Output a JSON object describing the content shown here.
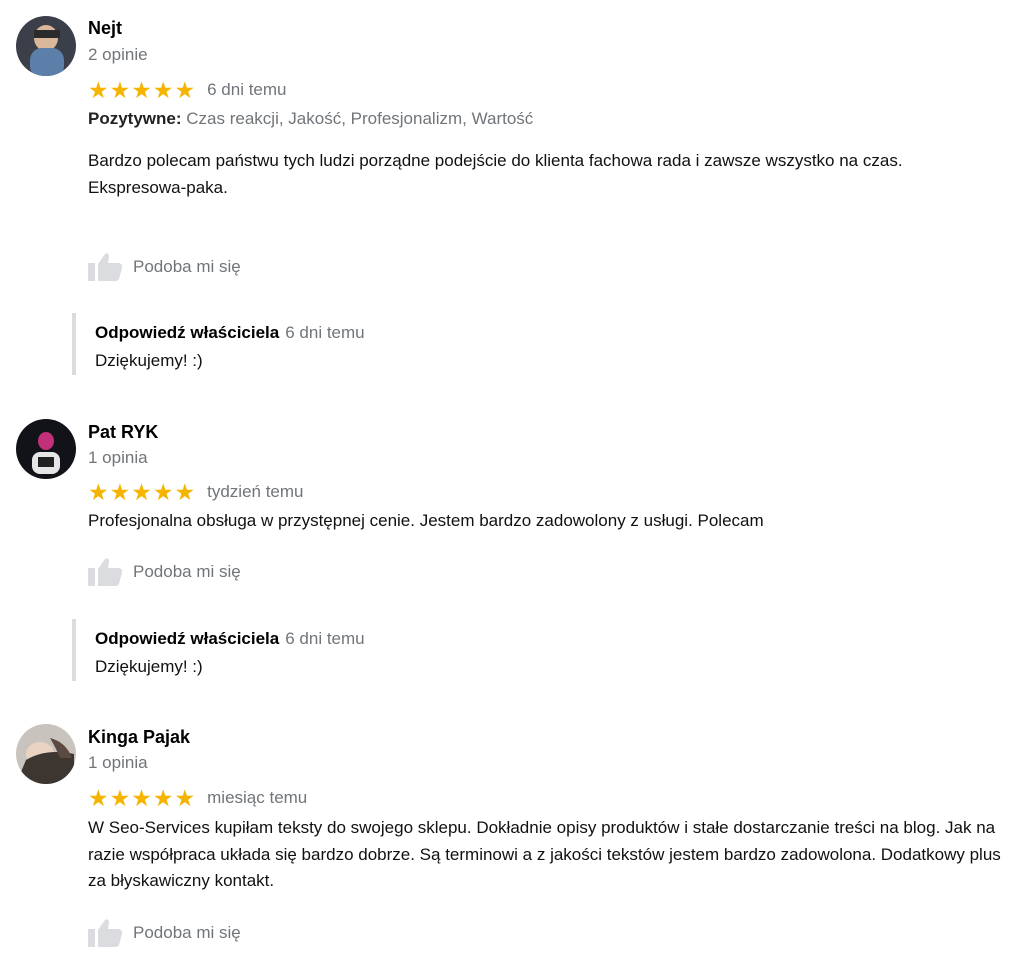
{
  "reviews": [
    {
      "name": "Nejt",
      "review_count": "2 opinie",
      "rating": 5,
      "when": "6 dni temu",
      "attributes": {
        "label": "Pozytywne:",
        "values": "Czas reakcji, Jakość, Profesjonalizm, Wartość"
      },
      "text_lines": [
        "Bardzo polecam państwu tych ludzi porządne podejście do klienta fachowa rada i zawsze wszystko na czas.",
        "Ekspresowa-paka."
      ],
      "like_label": "Podoba mi się",
      "reply": {
        "title": "Odpowiedź właściciela",
        "when": "6 dni temu",
        "text": "Dziękujemy! :)"
      }
    },
    {
      "name": "Pat RYK",
      "review_count": "1 opinia",
      "rating": 5,
      "when": "tydzień temu",
      "text_lines": [
        "Profesjonalna obsługa w przystępnej cenie. Jestem bardzo zadowolony z usługi. Polecam"
      ],
      "like_label": "Podoba mi się",
      "reply": {
        "title": "Odpowiedź właściciela",
        "when": "6 dni temu",
        "text": "Dziękujemy! :)"
      }
    },
    {
      "name": "Kinga Pajak",
      "review_count": "1 opinia",
      "rating": 5,
      "when": "miesiąc temu",
      "text_lines": [
        "W Seo-Services kupiłam teksty do swojego sklepu. Dokładnie opisy produktów i stałe dostarczanie treści na blog. Jak na razie współpraca układa się bardzo dobrze. Są terminowi a z jakości tekstów jestem bardzo zadowolona. Dodatkowy plus za błyskawiczny kontakt."
      ],
      "like_label": "Podoba mi się"
    }
  ],
  "colors": {
    "star": "#f4b400",
    "muted": "#70757a",
    "reply_border": "#dadce0"
  }
}
